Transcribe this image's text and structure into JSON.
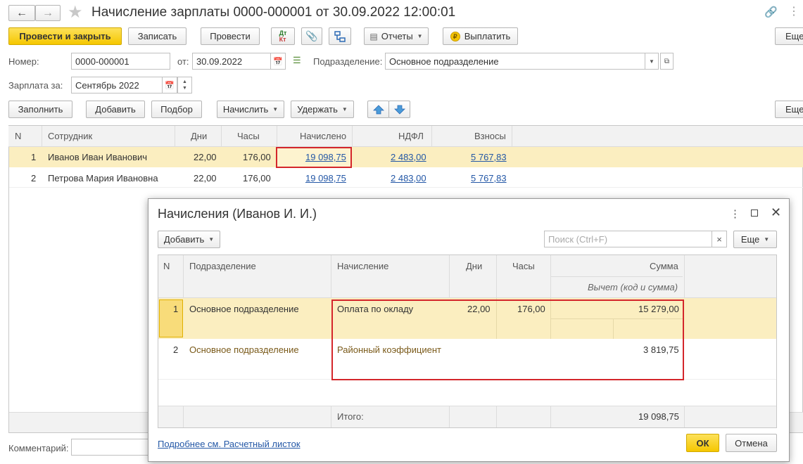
{
  "window": {
    "title": "Начисление зарплаты 0000-000001 от 30.09.2022 12:00:01"
  },
  "toolbar": {
    "post_close": "Провести и закрыть",
    "write": "Записать",
    "post": "Провести",
    "dtkt_top": "Дт",
    "dtkt_bottom": "Кт",
    "reports": "Отчеты",
    "pay": "Выплатить",
    "more": "Еще"
  },
  "header_fields": {
    "number_label": "Номер:",
    "number_value": "0000-000001",
    "from_label": "от:",
    "date_value": "30.09.2022",
    "division_label": "Подразделение:",
    "division_value": "Основное подразделение",
    "salary_for_label": "Зарплата за:",
    "salary_for_value": "Сентябрь 2022"
  },
  "table_toolbar": {
    "fill": "Заполнить",
    "add": "Добавить",
    "pick": "Подбор",
    "accrue": "Начислить",
    "withhold": "Удержать",
    "more": "Еще"
  },
  "main_table": {
    "columns": [
      "N",
      "Сотрудник",
      "Дни",
      "Часы",
      "Начислено",
      "НДФЛ",
      "Взносы"
    ],
    "rows": [
      {
        "n": "1",
        "employee": "Иванов Иван Иванович",
        "days": "22,00",
        "hours": "176,00",
        "accrued": "19 098,75",
        "ndfl": "2 483,00",
        "contrib": "5 767,83"
      },
      {
        "n": "2",
        "employee": "Петрова Мария Ивановна",
        "days": "22,00",
        "hours": "176,00",
        "accrued": "19 098,75",
        "ndfl": "2 483,00",
        "contrib": "5 767,83"
      }
    ]
  },
  "comment_label": "Комментарий:",
  "dialog": {
    "title": "Начисления (Иванов И. И.)",
    "add": "Добавить",
    "search_placeholder": "Поиск (Ctrl+F)",
    "clear": "×",
    "more": "Еще",
    "columns": {
      "n": "N",
      "division": "Подразделение",
      "accrual": "Начисление",
      "days": "Дни",
      "hours": "Часы",
      "sum": "Сумма",
      "deduction": "Вычет (код и сумма)"
    },
    "rows": [
      {
        "n": "1",
        "division": "Основное подразделение",
        "accrual": "Оплата по окладу",
        "days": "22,00",
        "hours": "176,00",
        "sum": "15 279,00"
      },
      {
        "n": "2",
        "division": "Основное подразделение",
        "accrual": "Районный коэффициент",
        "days": "",
        "hours": "",
        "sum": "3 819,75"
      }
    ],
    "total_label": "Итого:",
    "total_value": "19 098,75",
    "link": "Подробнее см. Расчетный листок",
    "ok": "ОК",
    "cancel": "Отмена"
  },
  "colors": {
    "selected_row": "#fbeec0",
    "highlight_border": "#d4262b",
    "link": "#2357a6",
    "accent_button": "#f5c700"
  }
}
